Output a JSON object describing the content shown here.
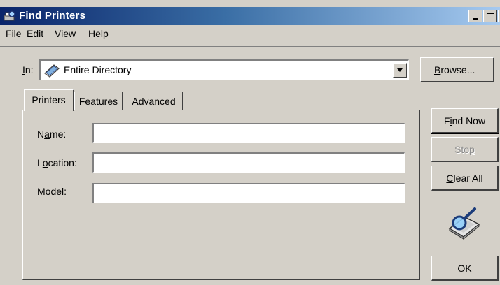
{
  "window": {
    "title": "Find Printers",
    "title_icon": "find-printers-icon"
  },
  "menu": {
    "items": [
      {
        "label": "File",
        "mnemonic": "F",
        "rest": "ile"
      },
      {
        "label": "Edit",
        "mnemonic": "E",
        "rest": "dit"
      },
      {
        "label": "View",
        "mnemonic": "V",
        "rest": "iew"
      },
      {
        "label": "Help",
        "mnemonic": "H",
        "rest": "elp"
      }
    ]
  },
  "in_field": {
    "label_mnemonic": "I",
    "label_rest": "n:",
    "value": "Entire Directory",
    "icon": "directory-icon"
  },
  "buttons": {
    "browse": {
      "pre": "",
      "mnemonic": "B",
      "post": "rowse..."
    },
    "find_now": {
      "pre": "F",
      "mnemonic": "i",
      "post": "nd Now"
    },
    "stop": {
      "pre": "Sto",
      "mnemonic": "p",
      "post": "",
      "disabled": true
    },
    "clear_all": {
      "pre": "",
      "mnemonic": "C",
      "post": "lear All"
    },
    "ok": {
      "label": "OK"
    }
  },
  "tabs": [
    {
      "label": "Printers",
      "active": true
    },
    {
      "label": "Features",
      "active": false
    },
    {
      "label": "Advanced",
      "active": false
    }
  ],
  "fields": {
    "name": {
      "pre": "N",
      "mnemonic": "a",
      "post": "me:",
      "value": ""
    },
    "location": {
      "pre": "L",
      "mnemonic": "o",
      "post": "cation:",
      "value": ""
    },
    "model": {
      "pre": "",
      "mnemonic": "M",
      "post": "odel:",
      "value": ""
    }
  },
  "colors": {
    "face": "#d4d0c8",
    "title_start": "#0a246a",
    "title_end": "#a6caf0",
    "disabled_text": "#8a8a8a"
  }
}
